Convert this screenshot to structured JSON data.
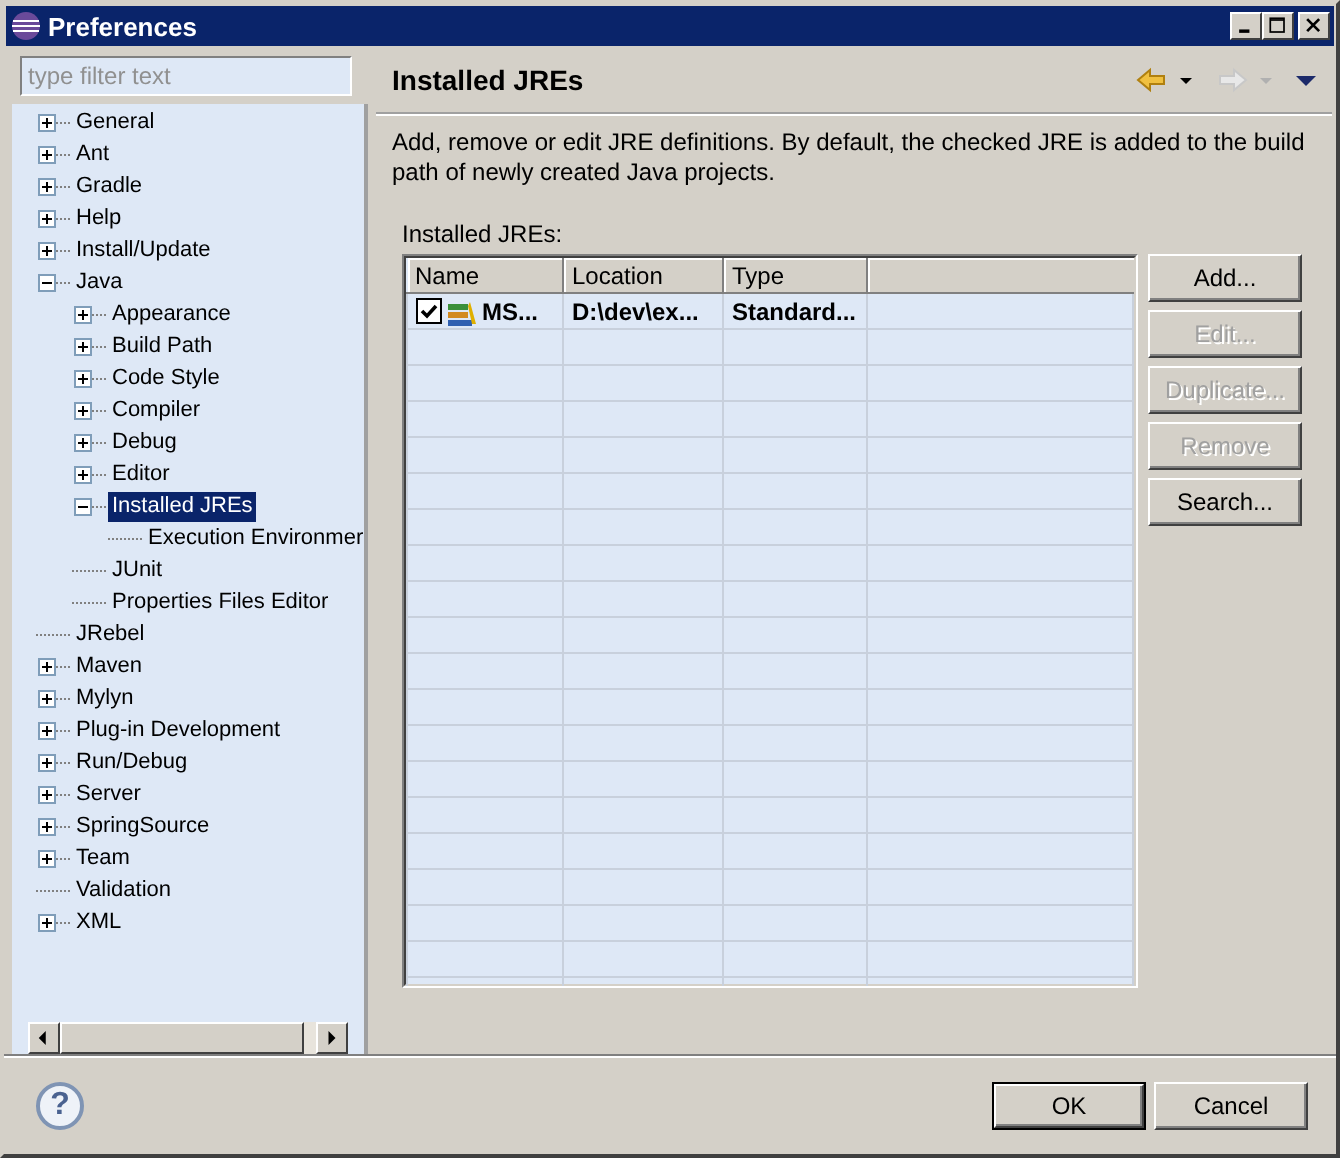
{
  "window": {
    "title": "Preferences"
  },
  "filter": {
    "placeholder": "type filter text"
  },
  "tree": [
    {
      "label": "General",
      "kind": "group",
      "expanded": false,
      "selected": false
    },
    {
      "label": "Ant",
      "kind": "group",
      "expanded": false,
      "selected": false
    },
    {
      "label": "Gradle",
      "kind": "group",
      "expanded": false,
      "selected": false
    },
    {
      "label": "Help",
      "kind": "group",
      "expanded": false,
      "selected": false
    },
    {
      "label": "Install/Update",
      "kind": "group",
      "expanded": false,
      "selected": false
    },
    {
      "label": "Java",
      "kind": "group",
      "expanded": true,
      "selected": false,
      "children": [
        {
          "label": "Appearance",
          "kind": "group",
          "expanded": false,
          "selected": false
        },
        {
          "label": "Build Path",
          "kind": "group",
          "expanded": false,
          "selected": false
        },
        {
          "label": "Code Style",
          "kind": "group",
          "expanded": false,
          "selected": false
        },
        {
          "label": "Compiler",
          "kind": "group",
          "expanded": false,
          "selected": false
        },
        {
          "label": "Debug",
          "kind": "group",
          "expanded": false,
          "selected": false
        },
        {
          "label": "Editor",
          "kind": "group",
          "expanded": false,
          "selected": false
        },
        {
          "label": "Installed JREs",
          "kind": "group",
          "expanded": true,
          "selected": true,
          "children": [
            {
              "label": "Execution Environmer",
              "kind": "leaf",
              "selected": false
            }
          ]
        },
        {
          "label": "JUnit",
          "kind": "leaf",
          "selected": false
        },
        {
          "label": "Properties Files Editor",
          "kind": "leaf",
          "selected": false
        }
      ]
    },
    {
      "label": "JRebel",
      "kind": "leaf",
      "selected": false
    },
    {
      "label": "Maven",
      "kind": "group",
      "expanded": false,
      "selected": false
    },
    {
      "label": "Mylyn",
      "kind": "group",
      "expanded": false,
      "selected": false
    },
    {
      "label": "Plug-in Development",
      "kind": "group",
      "expanded": false,
      "selected": false
    },
    {
      "label": "Run/Debug",
      "kind": "group",
      "expanded": false,
      "selected": false
    },
    {
      "label": "Server",
      "kind": "group",
      "expanded": false,
      "selected": false
    },
    {
      "label": "SpringSource",
      "kind": "group",
      "expanded": false,
      "selected": false
    },
    {
      "label": "Team",
      "kind": "group",
      "expanded": false,
      "selected": false
    },
    {
      "label": "Validation",
      "kind": "leaf",
      "selected": false
    },
    {
      "label": "XML",
      "kind": "group",
      "expanded": false,
      "selected": false
    }
  ],
  "page": {
    "title": "Installed JREs",
    "nav": [
      {
        "kind": "back",
        "disabled": false
      },
      {
        "kind": "forward",
        "disabled": true
      }
    ],
    "description": "Add, remove or edit JRE definitions. By default, the checked JRE is added to the build path of newly created Java projects.",
    "table_label": "Installed JREs:",
    "table": {
      "columns": [
        "Name",
        "Location",
        "Type"
      ],
      "rows": [
        {
          "checked": true,
          "name": "MS...",
          "location": "D:\\dev\\ex...",
          "type": "Standard..."
        }
      ]
    },
    "buttons": [
      {
        "label": "Add...",
        "disabled": false
      },
      {
        "label": "Edit...",
        "disabled": true
      },
      {
        "label": "Duplicate...",
        "disabled": true
      },
      {
        "label": "Remove",
        "disabled": true
      },
      {
        "label": "Search...",
        "disabled": false
      }
    ]
  },
  "help": {
    "glyph": "?"
  },
  "dialog_buttons": [
    {
      "label": "OK",
      "kind": "default"
    },
    {
      "label": "Cancel",
      "kind": "normal"
    }
  ]
}
